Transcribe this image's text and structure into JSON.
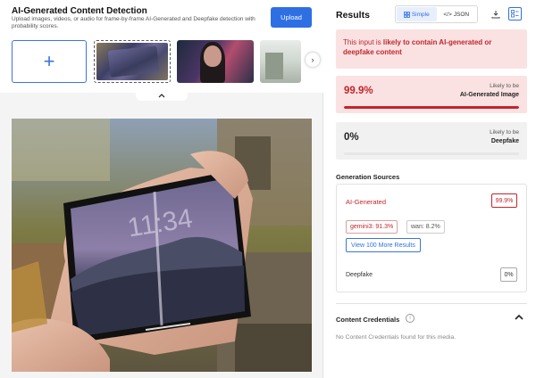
{
  "colors": {
    "accent": "#2f6fe4",
    "danger": "#c0262d",
    "danger_bg": "#fbe2e2",
    "neutral_bg": "#f1f1f1"
  },
  "header": {
    "title": "AI-Generated Content Detection",
    "subtitle": "Upload images, videos, or audio for frame-by-frame AI-Generated and Deepfake detection with probability scores.",
    "upload_label": "Upload"
  },
  "gallery": {
    "add_icon": "plus-icon",
    "next_icon": "chevron-right-icon",
    "collapse_icon": "chevron-up-icon"
  },
  "results": {
    "title": "Results",
    "view_options": [
      {
        "label": "Simple",
        "icon": "grid-icon",
        "active": true
      },
      {
        "label": "JSON",
        "icon": "code-icon",
        "active": false
      }
    ],
    "alert": {
      "prefix": "This input is ",
      "emphasis": "likely to contain AI-generated or deepfake content"
    },
    "scores": [
      {
        "value": "99.9%",
        "line1": "Likely to be",
        "line2": "AI-Generated Image",
        "fraction": 0.999
      },
      {
        "value": "0%",
        "line1": "Likely to be",
        "line2": "Deepfake",
        "fraction": 0.0
      }
    ]
  },
  "generation_sources": {
    "title": "Generation Sources",
    "ai_label": "AI-Generated",
    "ai_value": "99.9%",
    "chips": [
      "gemini3: 91.3%",
      "wan: 8.2%"
    ],
    "more_button": "View 100 More Results",
    "deepfake_label": "Deepfake",
    "deepfake_value": "0%"
  },
  "content_credentials": {
    "title": "Content Credentials",
    "info_icon": "info-icon",
    "message": "No Content Credentials found for this media."
  }
}
